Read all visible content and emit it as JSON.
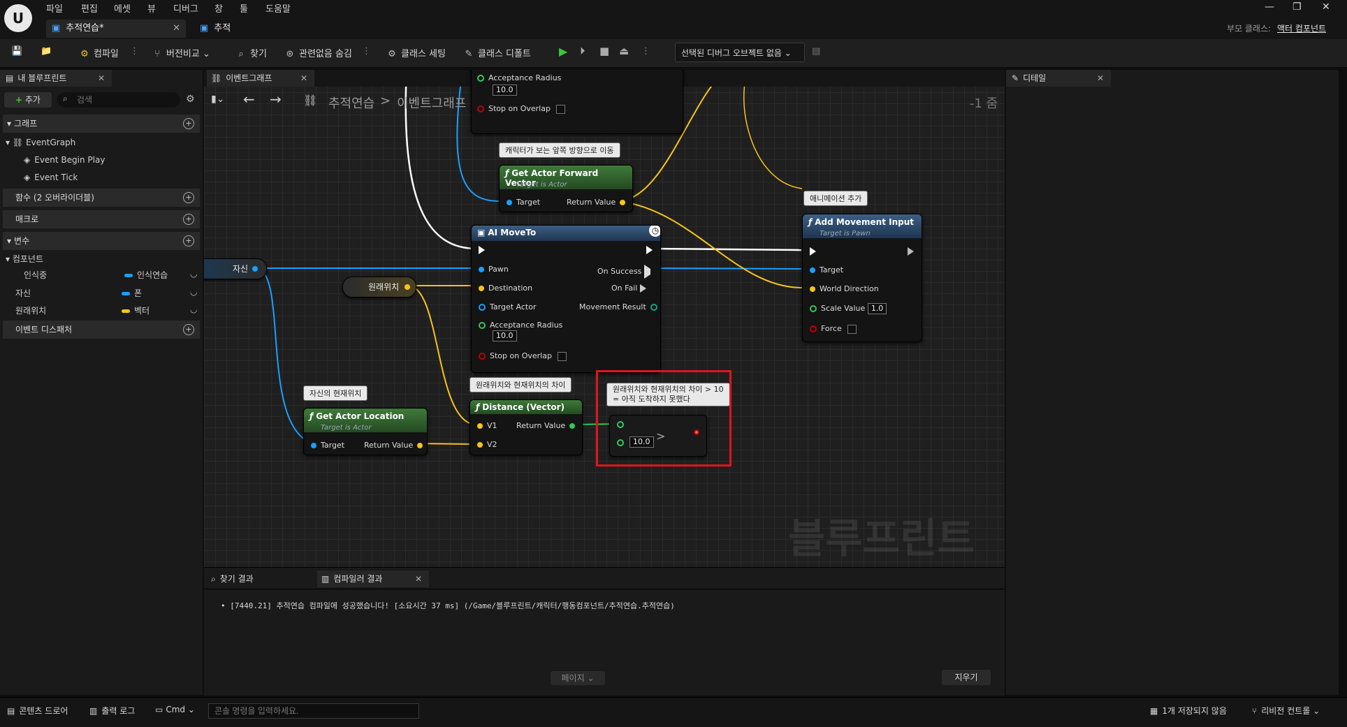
{
  "menu": [
    "파일",
    "편집",
    "에셋",
    "뷰",
    "디버그",
    "창",
    "툴",
    "도움말"
  ],
  "doc_tabs": [
    {
      "label": "추적연습*"
    },
    {
      "label": "추적"
    }
  ],
  "parent_class": {
    "label": "부모 클래스:",
    "value": "액터 컴포넌트"
  },
  "window_buttons": [
    "—",
    "❐",
    "✕"
  ],
  "toolbar": {
    "compile": "컴파일",
    "diff": "버전비교",
    "find": "찾기",
    "hide_unrelated": "관련없음 숨김",
    "class_settings": "클래스 세팅",
    "class_defaults": "클래스 디폴트",
    "debug_object": "선택된 디버그 오브젝트 없음"
  },
  "my_blueprint": {
    "tab": "내 블루프린트",
    "add": "추가",
    "search_placeholder": "검색",
    "graphs_section": "그래프",
    "event_graph": "EventGraph",
    "events": [
      "Event Begin Play",
      "Event Tick"
    ],
    "functions_section": "함수 (2 오버라이더블)",
    "macros_section": "매크로",
    "variables_section": "변수",
    "components_section": "컴포넌트",
    "variables": [
      {
        "name": "인식중",
        "type": "인식연습",
        "color": "#1aa0ff"
      },
      {
        "name": "자신",
        "type": "폰",
        "color": "#1aa0ff"
      },
      {
        "name": "원래위치",
        "type": "벡터",
        "color": "#f5c518"
      }
    ],
    "dispatchers_section": "이벤트 디스패처"
  },
  "graph": {
    "tab": "이벤트그래프",
    "breadcrumb_root": "추적연습",
    "breadcrumb_sep": ">",
    "breadcrumb_leaf": "이벤트그래프",
    "zoom": "-1 줌",
    "watermark": "블루프린트",
    "top_node": {
      "acceptance_label": "Acceptance Radius",
      "acceptance_value": "10.0",
      "stop_label": "Stop on Overlap"
    },
    "comments": {
      "forward": "캐릭터가 보는 앞쪽 방향으로 이동",
      "anim": "애니메이션 추가",
      "self_loc": "자신의 현재위치",
      "diff": "원래위치와 현재위치의 차이",
      "cond_line1": "원래위치와 현재위치의 차이 > 10",
      "cond_line2": "= 아직 도착하지 못했다"
    },
    "forward_node": {
      "title": "Get Actor Forward Vector",
      "subtitle": "Target is Actor",
      "target": "Target",
      "ret": "Return Value"
    },
    "aimove": {
      "title": "AI MoveTo",
      "pawn": "Pawn",
      "destination": "Destination",
      "target_actor": "Target Actor",
      "acceptance_label": "Acceptance Radius",
      "acceptance_value": "10.0",
      "stop_label": "Stop on Overlap",
      "on_success": "On Success",
      "on_fail": "On Fail",
      "movement_result": "Movement Result"
    },
    "addmove": {
      "title": "Add Movement Input",
      "subtitle": "Target is Pawn",
      "target": "Target",
      "direction": "World Direction",
      "scale_label": "Scale Value",
      "scale_value": "1.0",
      "force": "Force"
    },
    "self_var": "자신",
    "orig_var": "원래위치",
    "getloc": {
      "title": "Get Actor Location",
      "subtitle": "Target is Actor",
      "target": "Target",
      "ret": "Return Value"
    },
    "distance": {
      "title": "Distance (Vector)",
      "v1": "V1",
      "v2": "V2",
      "ret": "Return Value"
    },
    "compare": {
      "op": ">",
      "value": "10.0"
    }
  },
  "bottom": {
    "tab_find": "찾기 결과",
    "tab_compiler": "컴파일러 결과",
    "log": "[7440.21] 추적연습 컴파일에 성공했습니다! [소요시간 37 ms] (/Game/블루프린트/캐릭터/행동컴포넌트/추적연습.추적연습)",
    "page": "페이지",
    "clear": "지우기"
  },
  "details": {
    "tab": "디테일"
  },
  "status": {
    "content_drawer": "콘텐츠 드로어",
    "output_log": "출력 로그",
    "cmd": "Cmd",
    "console_placeholder": "콘솔 명령을 입력하세요.",
    "unsaved": "1개 저장되지 않음",
    "revision": "리비전 컨트롤"
  },
  "colors": {
    "exec": "#ffffff",
    "object": "#1aa0ff",
    "vector": "#f5c518",
    "float": "#34c759",
    "bool": "#c00000",
    "highlight": "#e0141e"
  }
}
